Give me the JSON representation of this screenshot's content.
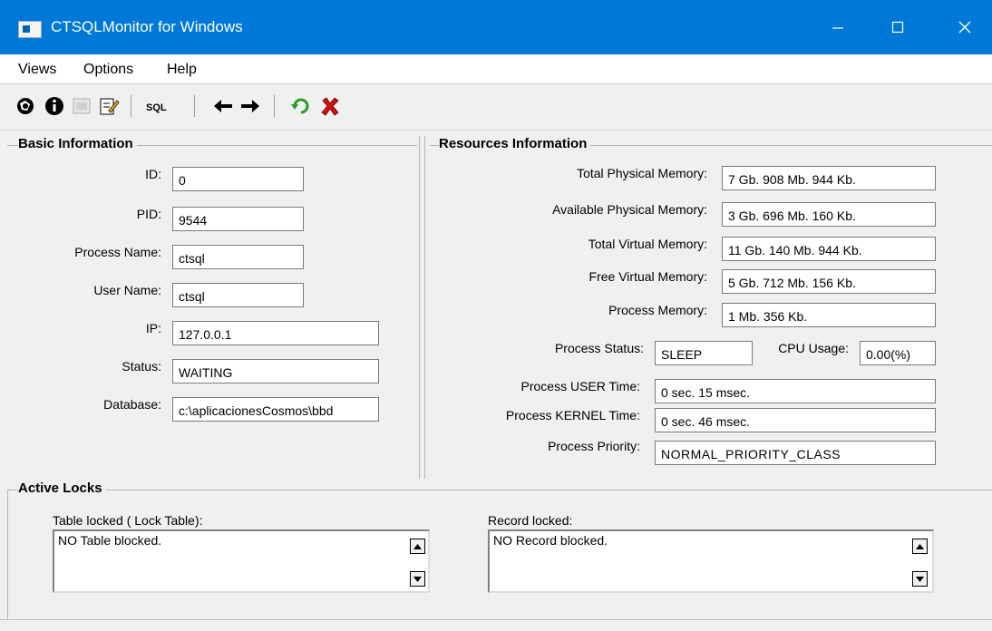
{
  "window": {
    "title": "CTSQLMonitor for Windows"
  },
  "menu": {
    "views": "Views",
    "options": "Options",
    "help": "Help"
  },
  "toolbar": {
    "icons": [
      "connect-icon",
      "info-icon",
      "disabled-icon",
      "edit-icon",
      "sql-icon",
      "back-arrow-icon",
      "forward-arrow-icon",
      "refresh-icon",
      "kill-icon"
    ],
    "sql_label": "SQL"
  },
  "basic": {
    "title": "Basic Information",
    "id_label": "ID:",
    "id_value": "0",
    "pid_label": "PID:",
    "pid_value": "9544",
    "pname_label": "Process Name:",
    "pname_value": "ctsql",
    "user_label": "User Name:",
    "user_value": "ctsql",
    "ip_label": "IP:",
    "ip_value": "127.0.0.1",
    "status_label": "Status:",
    "status_value": "WAITING",
    "db_label": "Database:",
    "db_value": "c:\\aplicacionesCosmos\\bbd"
  },
  "resources": {
    "title": "Resources Information",
    "tpm_label": "Total Physical Memory:",
    "tpm_value": "7 Gb. 908 Mb. 944 Kb.",
    "apm_label": "Available Physical Memory:",
    "apm_value": "3 Gb. 696 Mb. 160 Kb.",
    "tvm_label": "Total Virtual Memory:",
    "tvm_value": "11 Gb. 140 Mb. 944 Kb.",
    "fvm_label": "Free Virtual Memory:",
    "fvm_value": "5 Gb. 712 Mb. 156 Kb.",
    "pm_label": "Process Memory:",
    "pm_value": "1 Mb. 356 Kb.",
    "pstatus_label": "Process Status:",
    "pstatus_value": "SLEEP",
    "cpu_label": "CPU Usage:",
    "cpu_value": "0.00(%)",
    "user_time_label": "Process USER Time:",
    "user_time_value": "0 sec. 15 msec.",
    "kernel_time_label": "Process KERNEL Time:",
    "kernel_time_value": "0 sec. 46 msec.",
    "priority_label": "Process Priority:",
    "priority_value": "NORMAL_PRIORITY_CLASS"
  },
  "locks": {
    "title": "Active Locks",
    "table_label": "Table locked ( Lock Table):",
    "table_text": "NO Table blocked.",
    "record_label": "Record locked:",
    "record_text": "NO Record blocked."
  }
}
